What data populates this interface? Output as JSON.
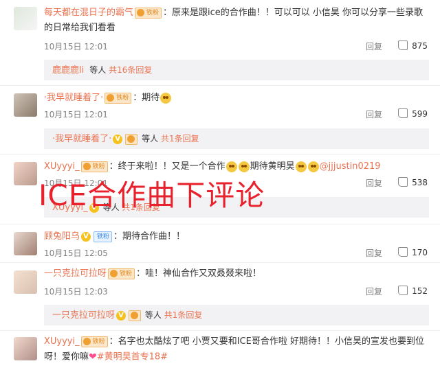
{
  "comments": [
    {
      "user": "每天都在混日子的霸气",
      "badge": "铁粉",
      "text_line1": "：原来是跟ice的合作曲！！可以可以 小信昊 你可以分享一些录歌",
      "text_line2": "的日常给我们看看",
      "time": "10月15日 12:01",
      "reply": "回复",
      "likes": "875",
      "sub_user": "鹿鹿鹿li",
      "sub_deng": "等人",
      "sub_count": "共16条回复"
    },
    {
      "user": "·我早就睡着了·",
      "badge": "铁粉",
      "text": "：期待",
      "time": "10月15日 12:01",
      "reply": "回复",
      "likes": "599",
      "sub_user": "·我早就睡着了·",
      "sub_deng": "等人",
      "sub_count": "共1条回复"
    },
    {
      "user": "XUyyyi_",
      "badge": "铁粉",
      "text_a": "：终于来啦！！又是一个合作",
      "text_b": "期待黄明昊",
      "mention": "@jjjustin0219",
      "time": "10月15日 12:01",
      "reply": "回复",
      "likes": "538",
      "sub_user": "XUyyyi_",
      "sub_deng": "等人",
      "sub_count": "共1条回复"
    },
    {
      "user": "顾兔阳乌",
      "badge": "铁粉",
      "text": "：期待合作曲！！",
      "time": "10月15日 12:05",
      "reply": "回复",
      "likes": "170"
    },
    {
      "user": "一只克拉可拉呀",
      "badge": "铁粉",
      "text": "：哇！神仙合作又双叒叕来啦！",
      "time": "10月15日 12:03",
      "reply": "回复",
      "likes": "152",
      "sub_user": "一只克拉可拉呀",
      "sub_deng": "等人",
      "sub_count": "共1条回复"
    },
    {
      "user": "XUyyyi_",
      "badge": "铁粉",
      "text_line1": "：名字也太酷炫了吧 小贾又要和ICE哥合作啦 好期待！！小信昊的宣发也要到位",
      "text_line2a": "呀！爱你嘛",
      "hashtag": "#黄明昊首专18#"
    }
  ],
  "overlay_text": "ICE合作曲下评论",
  "colors": {
    "username": "#eb7350",
    "overlay": "#e8222d",
    "subbg": "#f2f2f5"
  }
}
